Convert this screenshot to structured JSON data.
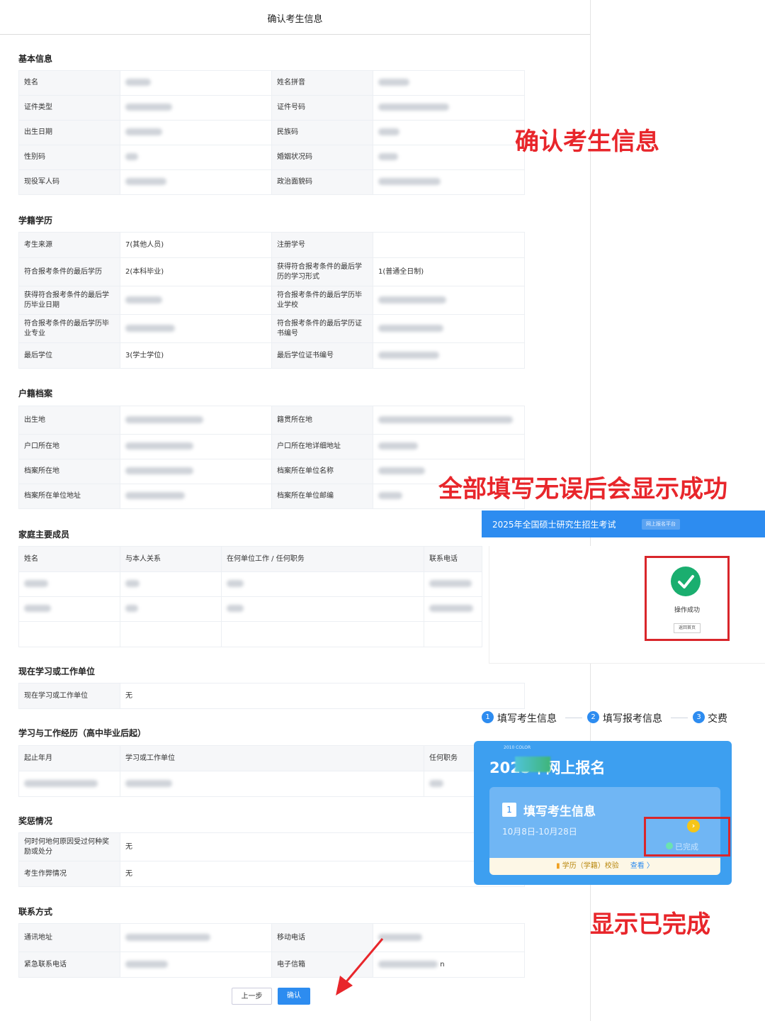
{
  "form": {
    "title": "确认考生信息",
    "basic": {
      "title": "基本信息",
      "rows": [
        [
          "姓名",
          "",
          "姓名拼音",
          ""
        ],
        [
          "证件类型",
          "",
          "证件号码",
          ""
        ],
        [
          "出生日期",
          "",
          "民族码",
          ""
        ],
        [
          "性别码",
          "",
          "婚姻状况码",
          ""
        ],
        [
          "现役军人码",
          "",
          "政治面貌码",
          ""
        ]
      ]
    },
    "education": {
      "title": "学籍学历",
      "rows": [
        [
          "考生来源",
          "7(其他人员)",
          "注册学号",
          ""
        ],
        [
          "符合报考条件的最后学历",
          "2(本科毕业)",
          "获得符合报考条件的最后学历的学习形式",
          "1(普通全日制)"
        ],
        [
          "获得符合报考条件的最后学历毕业日期",
          "",
          "符合报考条件的最后学历毕业学校",
          ""
        ],
        [
          "符合报考条件的最后学历毕业专业",
          "",
          "符合报考条件的最后学历证书编号",
          ""
        ],
        [
          "最后学位",
          "3(学士学位)",
          "最后学位证书编号",
          ""
        ]
      ]
    },
    "household": {
      "title": "户籍档案",
      "rows": [
        [
          "出生地",
          "",
          "籍贯所在地",
          ""
        ],
        [
          "户口所在地",
          "",
          "户口所在地详细地址",
          ""
        ],
        [
          "档案所在地",
          "",
          "档案所在单位名称",
          ""
        ],
        [
          "档案所在单位地址",
          "",
          "档案所在单位邮编",
          ""
        ]
      ]
    },
    "family": {
      "title": "家庭主要成员",
      "headers": [
        "姓名",
        "与本人关系",
        "在何单位工作 / 任何职务",
        "联系电话"
      ]
    },
    "current_unit": {
      "title": "现在学习或工作单位",
      "label": "现在学习或工作单位",
      "value": "无"
    },
    "history": {
      "title": "学习与工作经历（高中毕业后起）",
      "headers": [
        "起止年月",
        "学习或工作单位",
        "任何职务"
      ]
    },
    "rewards": {
      "title": "奖惩情况",
      "rows": [
        [
          "何时何地何原因受过何种奖励或处分",
          "无"
        ],
        [
          "考生作弊情况",
          "无"
        ]
      ]
    },
    "contact": {
      "title": "联系方式",
      "rows": [
        [
          "通讯地址",
          "",
          "移动电话",
          ""
        ],
        [
          "紧急联系电话",
          "",
          "电子信箱",
          "n"
        ]
      ]
    },
    "prev_button": "上一步",
    "confirm_button": "确认"
  },
  "annotations": {
    "confirm_info": "确认考生信息",
    "success_note": "全部填写无误后会显示成功",
    "completed_note": "显示已完成"
  },
  "success_panel": {
    "title": "2025年全国硕士研究生招生考试",
    "chip": "网上报名平台",
    "message": "操作成功",
    "button": "返回首页"
  },
  "steps": [
    {
      "num": "1",
      "label": "填写考生信息"
    },
    {
      "num": "2",
      "label": "填写报考信息"
    },
    {
      "num": "3",
      "label": "交费"
    }
  ],
  "card": {
    "small_text": "2010 COLOR",
    "title": "2025年网上报名",
    "step_num": "1",
    "step_title": "填写考生信息",
    "date_range": "10月8日-10月28日",
    "status": "已完成",
    "footer_text": "学历（学籍）校验",
    "footer_link": "查看 〉"
  },
  "colors": {
    "primary": "#2d8cf0",
    "annotation_red": "#e8262b",
    "success_green": "#1aae6f"
  }
}
